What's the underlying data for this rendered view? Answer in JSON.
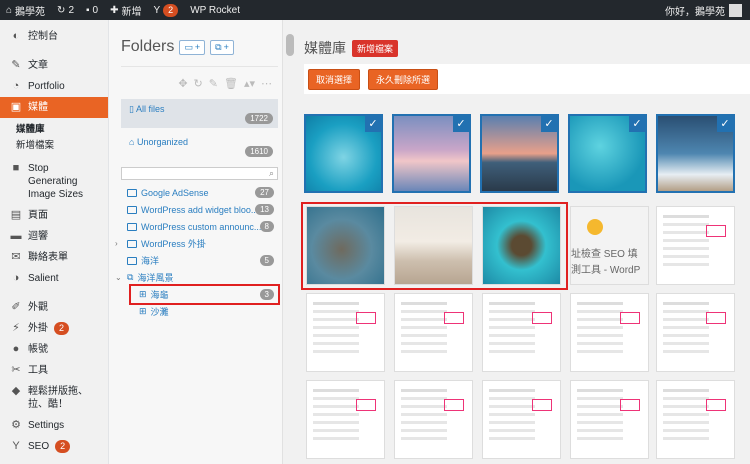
{
  "adminbar": {
    "site": "鵝學苑",
    "updates": "2",
    "comments": "0",
    "new": "新增",
    "seo_count": "2",
    "rocket": "WP Rocket",
    "greeting": "你好，鵝學苑"
  },
  "sidebar": {
    "items": [
      {
        "icon": "dashboard-icon",
        "label": "控制台"
      },
      {
        "icon": "pin-icon",
        "label": "文章"
      },
      {
        "icon": "portfolio-icon",
        "label": "Portfolio"
      },
      {
        "icon": "media-icon",
        "label": "媒體"
      },
      {
        "icon": "stop-icon",
        "label": "Stop Generating Image Sizes"
      },
      {
        "icon": "page-icon",
        "label": "頁面"
      },
      {
        "icon": "comment-icon",
        "label": "迴響"
      },
      {
        "icon": "mail-icon",
        "label": "聯絡表單"
      },
      {
        "icon": "salient-icon",
        "label": "Salient"
      },
      {
        "icon": "brush-icon",
        "label": "外觀"
      },
      {
        "icon": "plugin-icon",
        "label": "外掛",
        "badge": "2"
      },
      {
        "icon": "user-icon",
        "label": "帳號"
      },
      {
        "icon": "tools-icon",
        "label": "工具"
      },
      {
        "icon": "dragdrop-icon",
        "label": "輕鬆拼版拖、拉、酷！"
      },
      {
        "icon": "settings-icon",
        "label": "Settings"
      },
      {
        "icon": "seo-icon",
        "label": "SEO",
        "badge": "2"
      }
    ],
    "submenu": {
      "library": "媒體庫",
      "add_new": "新增檔案"
    }
  },
  "folders": {
    "title": "Folders",
    "new_folder_btn": "+",
    "new_cat_btn": "+",
    "all_files": {
      "label": "All files",
      "count": "1722"
    },
    "unorganized": {
      "label": "Unorganized",
      "count": "1610"
    },
    "tree": [
      {
        "label": "Google AdSense",
        "count": "27"
      },
      {
        "label": "WordPress add widget bloo...",
        "count": "13"
      },
      {
        "label": "WordPress custom announc...",
        "count": "8"
      },
      {
        "label": "WordPress 外掛",
        "count": ""
      },
      {
        "label": "海洋",
        "count": "5"
      },
      {
        "label": "海洋風景",
        "count": ""
      }
    ],
    "children": [
      {
        "label": "海龜",
        "count": "3"
      },
      {
        "label": "沙灘",
        "count": ""
      }
    ]
  },
  "main": {
    "title": "媒體庫",
    "add_new": "新增檔案",
    "deselect": "取消選擇",
    "delete_selected": "永久刪除所選",
    "overlay_text_1": "址檢查 SEO 填",
    "overlay_text_2": "測工具 - WordP",
    "selected_count": 5,
    "colors": {
      "accent": "#e96424",
      "selected_border": "#2271b1",
      "highlight": "#e02020"
    }
  }
}
